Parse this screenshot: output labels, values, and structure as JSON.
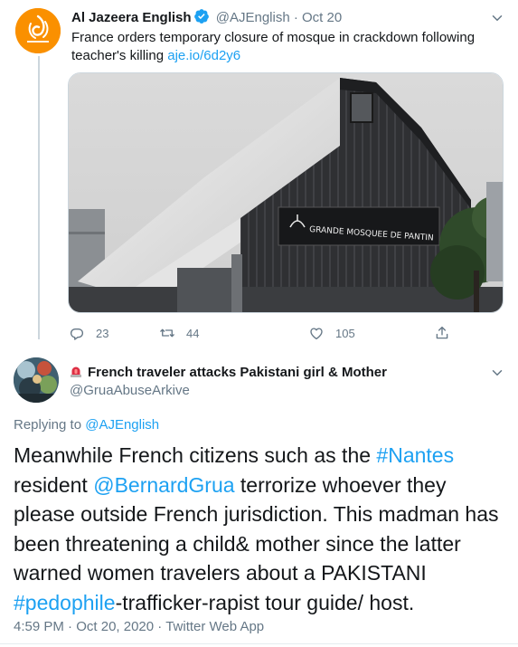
{
  "tweet1": {
    "name": "Al Jazeera English",
    "handle": "@AJEnglish",
    "separator": "·",
    "date": "Oct 20",
    "text": "France orders temporary closure of mosque in crackdown following teacher's killing ",
    "link": "aje.io/6d2y6",
    "image_sign": "GRANDE MOSQUEE DE PANTIN",
    "reply_count": "23",
    "retweet_count": "44",
    "like_count": "105"
  },
  "tweet2": {
    "name": "French traveler attacks Pakistani girl & Mother",
    "handle": "@GruaAbuseArkive",
    "replying_prefix": "Replying to ",
    "replying_handle": "@AJEnglish",
    "text_parts": [
      "Meanwhile French citizens such as the ",
      "#Nantes",
      " resident ",
      "@BernardGrua",
      " terrorize whoever they please outside French jurisdiction. This madman has been threatening a child& mother since the latter warned women travelers about a PAKISTANI ",
      "#pedophile",
      "-trafficker-rapist tour guide/ host."
    ],
    "time": "4:59 PM",
    "date": "Oct 20, 2020",
    "source": "Twitter Web App",
    "meta_sep": " · "
  },
  "colors": {
    "link": "#1da1f2",
    "muted": "#657786",
    "brand_orange": "#fa9000"
  },
  "icons": [
    "verified-badge-icon",
    "chevron-down-icon",
    "reply-icon",
    "retweet-icon",
    "like-icon",
    "share-icon",
    "siren-icon"
  ]
}
